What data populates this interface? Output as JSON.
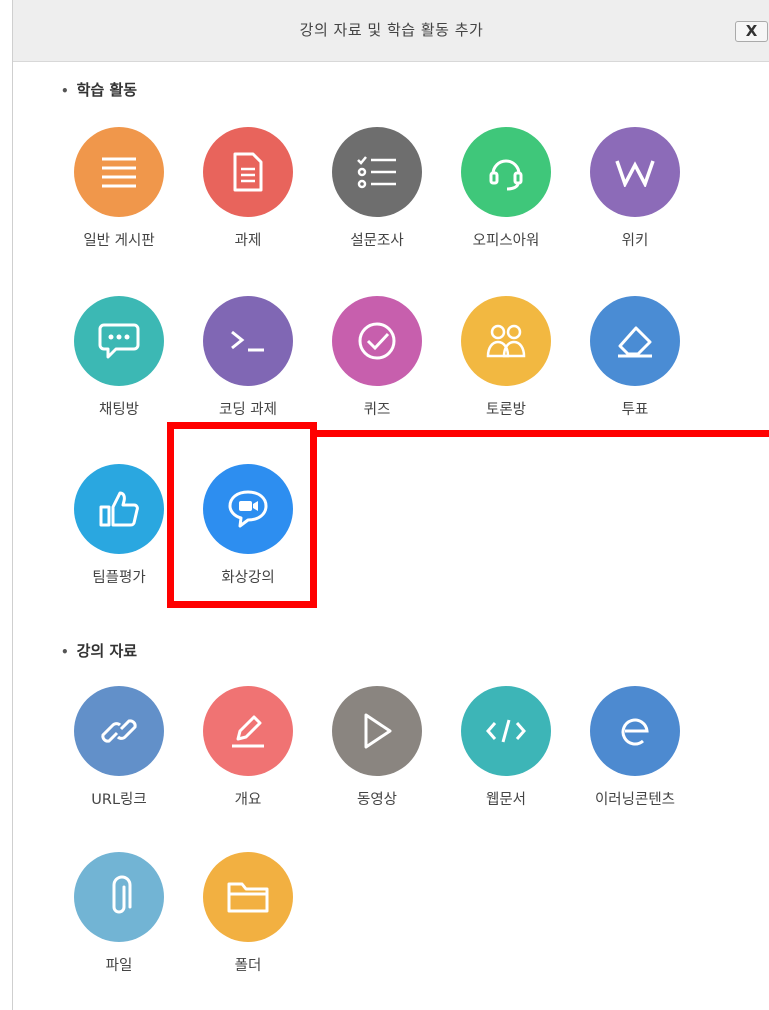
{
  "header": {
    "title": "강의 자료 및 학습 활동 추가",
    "close_label": "X"
  },
  "sections": {
    "activities": {
      "title": "학습 활동",
      "items": [
        {
          "label": "일반 게시판",
          "icon": "list-icon",
          "color": "#f0974b"
        },
        {
          "label": "과제",
          "icon": "document-icon",
          "color": "#e8645c"
        },
        {
          "label": "설문조사",
          "icon": "checklist-icon",
          "color": "#6e6e6e"
        },
        {
          "label": "오피스아워",
          "icon": "headset-icon",
          "color": "#3fc77a"
        },
        {
          "label": "위키",
          "icon": "wiki-w-icon",
          "color": "#8c6bb8"
        },
        {
          "label": "채팅방",
          "icon": "chat-bubble-icon",
          "color": "#3cb8b4"
        },
        {
          "label": "코딩 과제",
          "icon": "terminal-icon",
          "color": "#8067b4"
        },
        {
          "label": "퀴즈",
          "icon": "check-circle-icon",
          "color": "#c75fad"
        },
        {
          "label": "토론방",
          "icon": "people-icon",
          "color": "#f2b841"
        },
        {
          "label": "투표",
          "icon": "eraser-icon",
          "color": "#4a8cd4"
        },
        {
          "label": "팀플평가",
          "icon": "thumbs-up-icon",
          "color": "#2aa7e0"
        },
        {
          "label": "화상강의",
          "icon": "video-chat-icon",
          "color": "#2d8ef0"
        }
      ]
    },
    "materials": {
      "title": "강의 자료",
      "items": [
        {
          "label": "URL링크",
          "icon": "link-icon",
          "color": "#6290c9"
        },
        {
          "label": "개요",
          "icon": "pencil-icon",
          "color": "#f07373"
        },
        {
          "label": "동영상",
          "icon": "play-icon",
          "color": "#8a8580"
        },
        {
          "label": "웹문서",
          "icon": "code-icon",
          "color": "#3db5b7"
        },
        {
          "label": "이러닝콘텐츠",
          "icon": "elearning-e-icon",
          "color": "#4d8ad0"
        },
        {
          "label": "파일",
          "icon": "paperclip-icon",
          "color": "#72b4d4"
        },
        {
          "label": "폴더",
          "icon": "folder-icon",
          "color": "#f2b041"
        }
      ]
    }
  }
}
